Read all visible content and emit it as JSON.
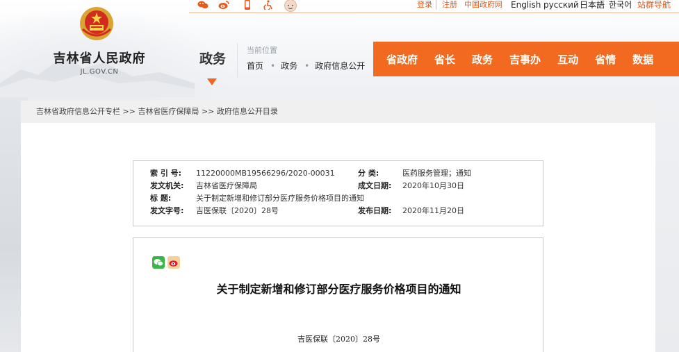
{
  "top": {
    "links": {
      "login": "登录",
      "register": "注册",
      "gov_cn": "中国政府网",
      "sitemap": "站群导航"
    },
    "languages": [
      "English",
      "русский",
      "日本語",
      "한국어"
    ],
    "icons": [
      "wechat-icon",
      "weibo-icon",
      "mobile-icon",
      "accessibility-icon",
      "elder-mode-icon"
    ]
  },
  "header": {
    "site_title": "吉林省人民政府",
    "site_domain": "JL.GOV.CN",
    "section": "政务",
    "location_label": "当前位置",
    "breadcrumb": [
      "首页",
      "政务",
      "政府信息公开"
    ]
  },
  "nav": [
    "省政府",
    "省长",
    "政务",
    "吉事办",
    "互动",
    "省情",
    "数据"
  ],
  "crumbbar": {
    "items": [
      "吉林省政府信息公开专栏",
      "吉林省医疗保障局",
      "政府信息公开目录"
    ],
    "separator": ">>"
  },
  "meta": {
    "index_label": "索 引 号:",
    "index_value": "11220000MB19566296/2020-00031",
    "category_label": "分 类:",
    "category_value": "医药服务管理；通知",
    "issuer_label": "发文机关:",
    "issuer_value": "吉林省医疗保障局",
    "created_label": "成文日期:",
    "created_value": "2020年10月30日",
    "title_label": "标 题:",
    "title_value": "关于制定新增和修订部分医疗服务价格项目的通知",
    "docno_label": "发文字号:",
    "docno_value": "吉医保联〔2020〕28号",
    "published_label": "发布日期:",
    "published_value": "2020年11月20日"
  },
  "article": {
    "title": "关于制定新增和修订部分医疗服务价格项目的通知",
    "doc_number": "吉医保联〔2020〕28号",
    "share_icons": [
      "wechat-share-icon",
      "weibo-share-icon"
    ]
  },
  "colors": {
    "brand_orange": "#f26a1f",
    "link_orange": "#e05a1c"
  }
}
